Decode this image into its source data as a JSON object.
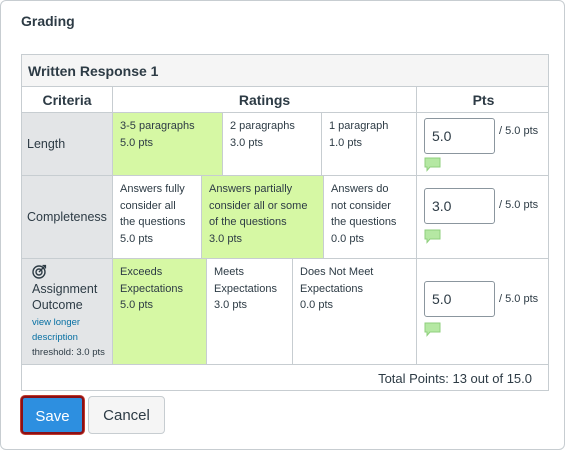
{
  "section_title": "Grading",
  "rubric": {
    "title": "Written Response 1",
    "headers": {
      "criteria": "Criteria",
      "ratings": "Ratings",
      "pts": "Pts"
    },
    "rows": [
      {
        "criterion": "Length",
        "ratings": [
          {
            "line1": "3-5 paragraphs",
            "points": "5.0 pts",
            "selected": true
          },
          {
            "line1": "2 paragraphs",
            "points": "3.0 pts",
            "selected": false
          },
          {
            "line1": "1 paragraph",
            "points": "1.0 pts",
            "selected": false
          }
        ],
        "score": "5.0",
        "out_of": "/ 5.0 pts"
      },
      {
        "criterion": "Completeness",
        "ratings": [
          {
            "line1": "Answers fully",
            "line2": "consider all",
            "line3": "the questions",
            "points": "5.0 pts",
            "selected": false
          },
          {
            "line1": "Answers partially",
            "line2": "consider all or some",
            "line3": "of the questions",
            "points": "3.0 pts",
            "selected": true
          },
          {
            "line1": "Answers do",
            "line2": "not consider",
            "line3": "the questions",
            "points": "0.0 pts",
            "selected": false
          }
        ],
        "score": "3.0",
        "out_of": "/ 5.0 pts"
      },
      {
        "criterion_line1": "Assignment",
        "criterion_line2": "Outcome",
        "link_line1": "view longer",
        "link_line2": "description",
        "threshold": "threshold: 3.0 pts",
        "ratings": [
          {
            "line1": "Exceeds",
            "line2": "Expectations",
            "points": "5.0 pts",
            "selected": true
          },
          {
            "line1": "Meets",
            "line2": "Expectations",
            "points": "3.0 pts",
            "selected": false
          },
          {
            "line1": "Does Not Meet",
            "line2": "Expectations",
            "points": "0.0 pts",
            "selected": false
          }
        ],
        "score": "5.0",
        "out_of": "/ 5.0 pts"
      }
    ],
    "total": "Total Points: 13 out of 15.0"
  },
  "buttons": {
    "save": "Save",
    "cancel": "Cancel"
  },
  "colors": {
    "selected_rating": "#d6f8a4",
    "criteria_bg": "#e3e5e7",
    "save_button": "#2d8fe0",
    "link": "#0770a3",
    "comment_icon": "#b5e8a3"
  }
}
